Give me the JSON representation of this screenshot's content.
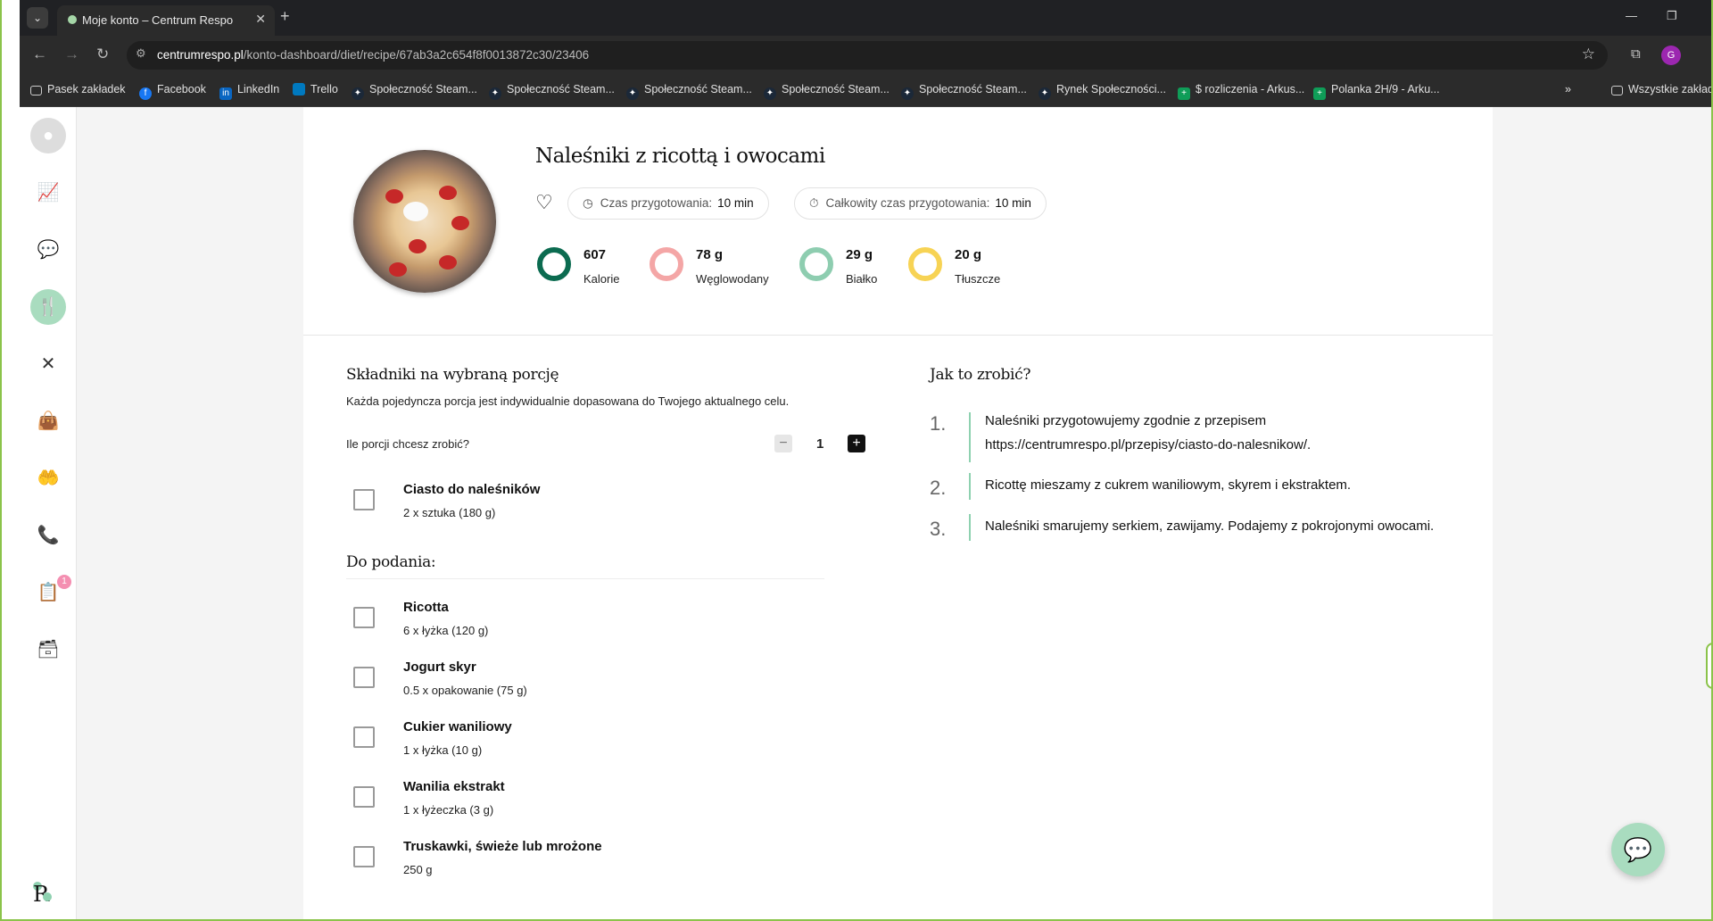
{
  "browser": {
    "tab_title": "Moje konto – Centrum Respo",
    "url_domain": "centrumrespo.pl",
    "url_path": "/konto-dashboard/diet/recipe/67ab3a2c654f8f0013872c30/23406",
    "profile_initial": "G",
    "bookmarks": [
      "Pasek zakładek",
      "Facebook",
      "LinkedIn",
      "Trello",
      "Społeczność Steam...",
      "Społeczność Steam...",
      "Społeczność Steam...",
      "Społeczność Steam...",
      "Społeczność Steam...",
      "Rynek Społeczności...",
      "$ rozliczenia - Arkus...",
      "Polanka 2H/9 - Arku..."
    ],
    "all_bookmarks": "Wszystkie zakładki"
  },
  "sidebar": {
    "notification_count": "1",
    "logo": "R"
  },
  "recipe": {
    "title": "Naleśniki z ricottą i owocami",
    "prep_label": "Czas przygotowania:",
    "prep_value": "10 min",
    "total_label": "Całkowity czas przygotowania:",
    "total_value": "10 min",
    "macros": [
      {
        "value": "607",
        "label": "Kalorie",
        "color": "#0b6b50"
      },
      {
        "value": "78 g",
        "label": "Węglowodany",
        "color": "#f4a6a6"
      },
      {
        "value": "29 g",
        "label": "Białko",
        "color": "#8ecdb0"
      },
      {
        "value": "20 g",
        "label": "Tłuszcze",
        "color": "#f7d354"
      }
    ]
  },
  "ingredients": {
    "heading": "Składniki na wybraną porcję",
    "subtitle": "Każda pojedyncza porcja jest indywidualnie dopasowana do Twojego aktualnego celu.",
    "portions_label": "Ile porcji chcesz zrobić?",
    "portions_value": "1",
    "main": [
      {
        "name": "Ciasto do naleśników",
        "qty": "2 x sztuka (180 g)"
      }
    ],
    "serving_heading": "Do podania:",
    "serving": [
      {
        "name": "Ricotta",
        "qty": "6 x łyżka (120 g)"
      },
      {
        "name": "Jogurt skyr",
        "qty": "0.5 x opakowanie (75 g)"
      },
      {
        "name": "Cukier waniliowy",
        "qty": "1 x łyżka (10 g)"
      },
      {
        "name": "Wanilia ekstrakt",
        "qty": "1 x łyżeczka (3 g)"
      },
      {
        "name": "Truskawki, świeże lub mrożone",
        "qty": "250 g"
      }
    ]
  },
  "steps": {
    "heading": "Jak to zrobić?",
    "items": [
      {
        "num": "1.",
        "text": "Naleśniki przygotowujemy zgodnie z przepisem https://centrumrespo.pl/przepisy/ciasto-do-nalesnikow/."
      },
      {
        "num": "2.",
        "text": "Ricottę mieszamy z cukrem waniliowym, skyrem i ekstraktem."
      },
      {
        "num": "3.",
        "text": "Naleśniki smarujemy serkiem, zawijamy. Podajemy z pokrojonymi owocami."
      }
    ]
  }
}
